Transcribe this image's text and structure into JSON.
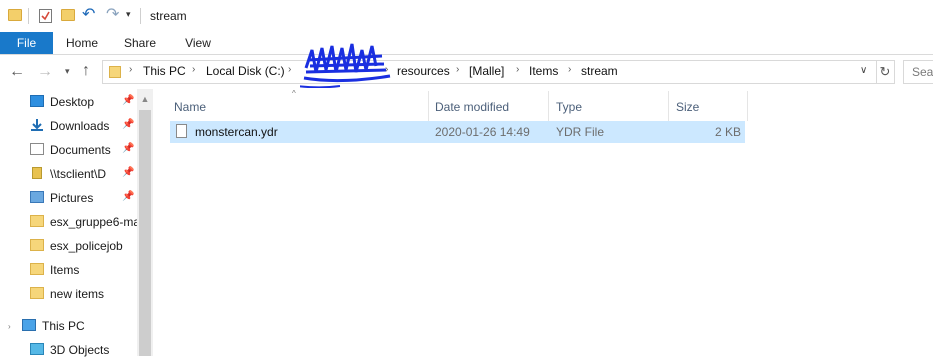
{
  "window": {
    "title": "stream"
  },
  "ribbon": {
    "tabs": [
      "File",
      "Home",
      "Share",
      "View"
    ]
  },
  "address": {
    "crumbs": [
      "This PC",
      "Local Disk (C:)",
      "resources",
      "[Malle]",
      "Items",
      "stream"
    ],
    "search_placeholder": "Sear"
  },
  "nav": {
    "items": [
      {
        "label": "Desktop",
        "pinned": true
      },
      {
        "label": "Downloads",
        "pinned": true
      },
      {
        "label": "Documents",
        "pinned": true
      },
      {
        "label": "\\\\tsclient\\D",
        "pinned": true
      },
      {
        "label": "Pictures",
        "pinned": true
      },
      {
        "label": "esx_gruppe6-ma",
        "pinned": false
      },
      {
        "label": "esx_policejob",
        "pinned": false
      },
      {
        "label": "Items",
        "pinned": false
      },
      {
        "label": "new items",
        "pinned": false
      }
    ],
    "this_pc": "This PC",
    "objects3d": "3D Objects"
  },
  "columns": {
    "name": "Name",
    "date": "Date modified",
    "type": "Type",
    "size": "Size"
  },
  "files": [
    {
      "name": "monstercan.ydr",
      "date": "2020-01-26 14:49",
      "type": "YDR File",
      "size": "2 KB"
    }
  ],
  "colors": {
    "accent": "#1979ca",
    "selection": "#cce8ff",
    "folder": "#f6d67a"
  }
}
